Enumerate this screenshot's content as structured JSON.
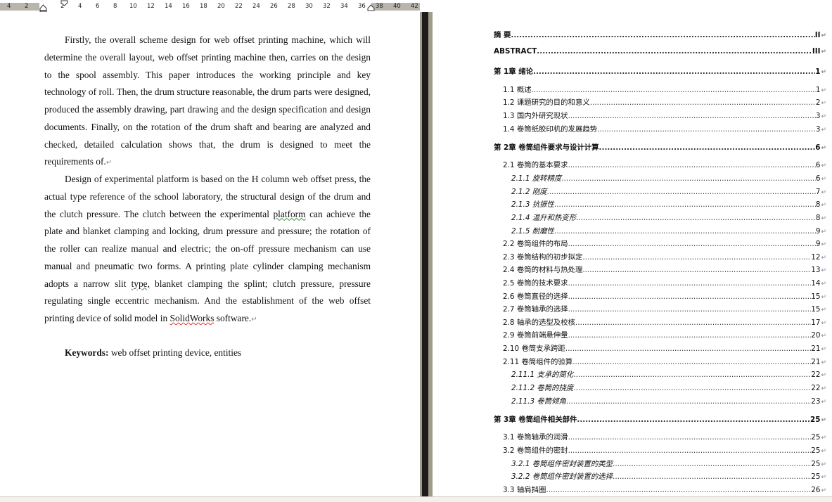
{
  "ruler": {
    "numbers": [
      "4",
      "2",
      "2",
      "4",
      "6",
      "8",
      "10",
      "12",
      "14",
      "16",
      "18",
      "20",
      "22",
      "24",
      "26",
      "28",
      "30",
      "32",
      "34",
      "36",
      "38",
      "40",
      "42"
    ]
  },
  "left_page": {
    "paragraph1": "Firstly, the overall scheme design for web offset printing machine, which will determine the overall layout, web offset printing machine then, carries on the design to the spool assembly. This paper introduces the working principle and key technology of roll. Then, the drum structure reasonable, the drum parts were designed, produced the assembly drawing, part drawing and the design specification and design documents. Finally, on the rotation of the drum shaft and bearing are analyzed and checked, detailed calculation shows that, the drum is designed to meet the requirements of.",
    "paragraph2_a": "Design of experimental platform is based on the H column web offset press, the actual type reference of the school laboratory, the structural design of the drum and the clutch pressure. The clutch between the experimental ",
    "paragraph2_sq1": "platform",
    "paragraph2_b": " can achieve the plate and blanket clamping and locking, drum pressure and pressure; the rotation of the roller can realize manual and electric; the on-off pressure mechanism can use manual and pneumatic two forms. A printing plate cylinder clamping mechanism adopts a narrow slit ",
    "paragraph2_sq2": "type,",
    "paragraph2_c": " blanket clamping the splint; clutch pressure, pressure regulating single eccentric mechanism. And the establishment of the web offset printing device of solid model in ",
    "paragraph2_sq3": "SolidWorks",
    "paragraph2_d": " software.",
    "keywords_label": "Keywords:",
    "keywords_text": " web offset printing device, entities",
    "paragraph_mark": "↵"
  },
  "toc": [
    {
      "label": "摘  要",
      "page": "II",
      "level": 1
    },
    {
      "label": "ABSTRACT",
      "page": "III",
      "level": 1
    },
    {
      "label": "第 1章  绪论",
      "page": "1",
      "level": 1
    },
    {
      "label": "1.1 概述",
      "page": "1",
      "level": 2
    },
    {
      "label": "1.2  课题研究的目的和意义",
      "page": "2",
      "level": 2
    },
    {
      "label": "1.3  国内外研究现状",
      "page": "3",
      "level": 2
    },
    {
      "label": "1.4 卷筒纸胶印机的发展趋势",
      "page": "3",
      "level": 2
    },
    {
      "label": "第 2章  卷筒组件要求与设计计算",
      "page": "6",
      "level": 1
    },
    {
      "label": "2.1 卷筒的基本要求",
      "page": "6",
      "level": 2
    },
    {
      "label": "2.1.1  旋转精度",
      "page": "6",
      "level": 3
    },
    {
      "label": "2.1.2   刚度",
      "page": "7",
      "level": 3
    },
    {
      "label": "2.1.3   抗振性",
      "page": "8",
      "level": 3
    },
    {
      "label": "2.1.4   温升和热变形",
      "page": "8",
      "level": 3
    },
    {
      "label": "2.1.5   耐磨性",
      "page": "9",
      "level": 3
    },
    {
      "label": "2.2 卷筒组件的布局",
      "page": "9",
      "level": 2
    },
    {
      "label": "2.3 卷筒结构的初步拟定",
      "page": "12",
      "level": 2
    },
    {
      "label": "2.4 卷筒的材料与热处理",
      "page": "13",
      "level": 2
    },
    {
      "label": "2.5 卷筒的技术要求",
      "page": "14",
      "level": 2
    },
    {
      "label": "2.6 卷筒直径的选择",
      "page": "15",
      "level": 2
    },
    {
      "label": "2.7 卷筒轴承的选择",
      "page": "15",
      "level": 2
    },
    {
      "label": "2.8  轴承的选型及校核",
      "page": "17",
      "level": 2
    },
    {
      "label": "2.9 卷筒前端悬伸量",
      "page": "20",
      "level": 2
    },
    {
      "label": "2.10 卷筒支承跨距",
      "page": "21",
      "level": 2
    },
    {
      "label": "2.11 卷筒组件的验算",
      "page": "21",
      "level": 2
    },
    {
      "label": "2.11.1  支承的简化",
      "page": "22",
      "level": 3
    },
    {
      "label": "2.11.2  卷筒的挠度",
      "page": "22",
      "level": 3
    },
    {
      "label": "2.11.3   卷筒倾角",
      "page": "23",
      "level": 3
    },
    {
      "label": "第 3章  卷筒组件相关部件",
      "page": "25",
      "level": 1
    },
    {
      "label": "3.1 卷筒轴承的润滑",
      "page": "25",
      "level": 2
    },
    {
      "label": "3.2 卷筒组件的密封",
      "page": "25",
      "level": 2
    },
    {
      "label": "3.2.1  卷筒组件密封装置的类型",
      "page": "25",
      "level": 3
    },
    {
      "label": "3.2.2   卷筒组件密封装置的选择",
      "page": "25",
      "level": 3
    },
    {
      "label": "3.3 轴肩挡圈",
      "page": "26",
      "level": 2
    }
  ],
  "colors": {
    "ruler_margin": "#b8b5ad",
    "divider": "#1c1c1c",
    "paragraph_mark": "#7d8a9c"
  }
}
